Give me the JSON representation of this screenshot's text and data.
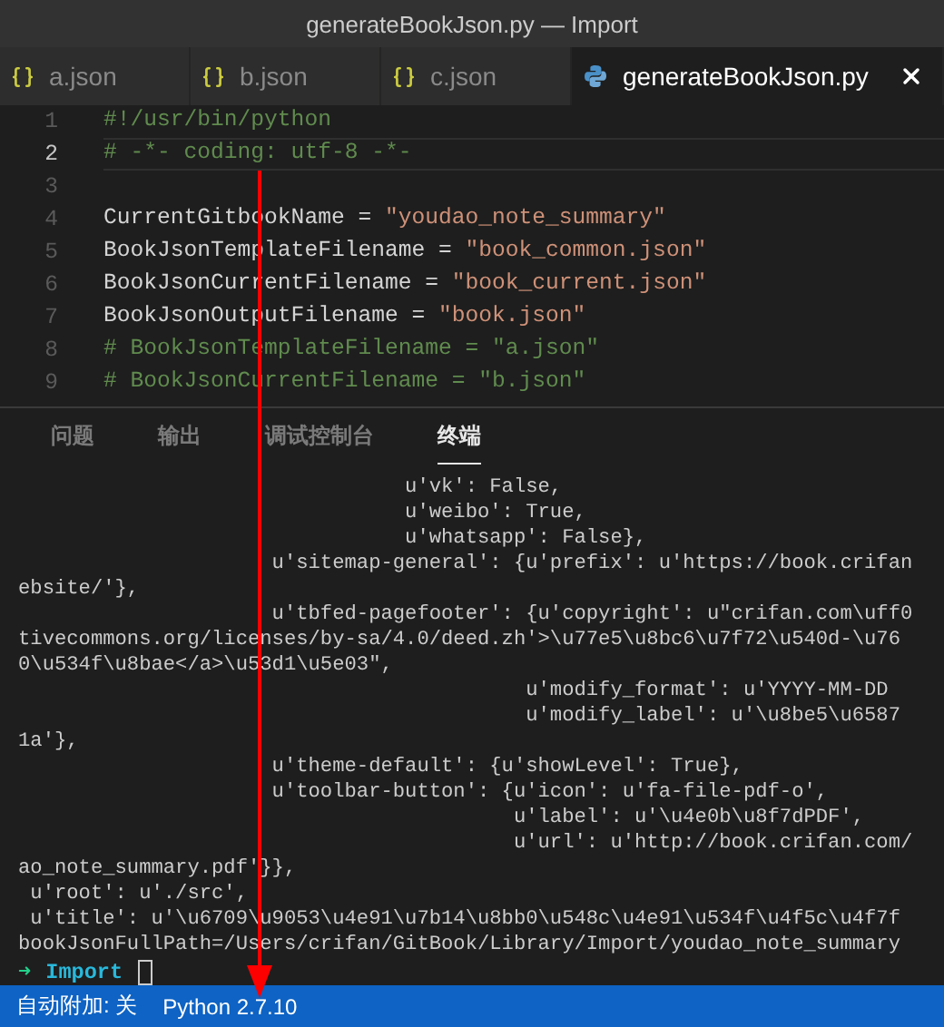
{
  "window": {
    "title": "generateBookJson.py — Import"
  },
  "tabs": [
    {
      "label": "a.json",
      "kind": "json",
      "selected": false
    },
    {
      "label": "b.json",
      "kind": "json",
      "selected": false
    },
    {
      "label": "c.json",
      "kind": "json",
      "selected": false
    },
    {
      "label": "generateBookJson.py",
      "kind": "python",
      "selected": true
    }
  ],
  "editor": {
    "lines": [
      {
        "number": "1",
        "active": false,
        "tokens": [
          {
            "text": "#!/usr/bin/python",
            "kind": "comment"
          }
        ]
      },
      {
        "number": "2",
        "active": true,
        "tokens": [
          {
            "text": "# -*- coding: utf-8 -*-",
            "kind": "comment"
          }
        ]
      },
      {
        "number": "3",
        "active": false
      },
      {
        "number": "4",
        "active": false,
        "tokens": [
          {
            "text": "CurrentGitbookName = ",
            "kind": "plain"
          },
          {
            "text": "\"youdao_note_summary\"",
            "kind": "string"
          }
        ]
      },
      {
        "number": "5",
        "active": false,
        "tokens": [
          {
            "text": "BookJsonTemplateFilename = ",
            "kind": "plain"
          },
          {
            "text": "\"book_common.json\"",
            "kind": "string"
          }
        ]
      },
      {
        "number": "6",
        "active": false,
        "tokens": [
          {
            "text": "BookJsonCurrentFilename = ",
            "kind": "plain"
          },
          {
            "text": "\"book_current.json\"",
            "kind": "string"
          }
        ]
      },
      {
        "number": "7",
        "active": false,
        "tokens": [
          {
            "text": "BookJsonOutputFilename = ",
            "kind": "plain"
          },
          {
            "text": "\"book.json\"",
            "kind": "string"
          }
        ]
      },
      {
        "number": "8",
        "active": false,
        "tokens": [
          {
            "text": "# BookJsonTemplateFilename = \"a.json\"",
            "kind": "comment"
          }
        ]
      },
      {
        "number": "9",
        "active": false,
        "tokens": [
          {
            "text": "# BookJsonCurrentFilename = \"b.json\"",
            "kind": "comment"
          }
        ]
      }
    ]
  },
  "panel": {
    "tabs": [
      {
        "label": "问题",
        "selected": false
      },
      {
        "label": "输出",
        "selected": false
      },
      {
        "label": "调试控制台",
        "selected": false
      },
      {
        "label": "终端",
        "selected": true
      }
    ],
    "terminal": {
      "lines": [
        "                                u'vk': False,",
        "                                u'weibo': True,",
        "                                u'whatsapp': False},",
        "                     u'sitemap-general': {u'prefix': u'https://book.crifan",
        "ebsite/'},",
        "                     u'tbfed-pagefooter': {u'copyright': u\"crifan.com\\uff0",
        "tivecommons.org/licenses/by-sa/4.0/deed.zh'>\\u77e5\\u8bc6\\u7f72\\u540d-\\u76",
        "0\\u534f\\u8bae</a>\\u53d1\\u5e03\",",
        "                                          u'modify_format': u'YYYY-MM-DD",
        "                                          u'modify_label': u'\\u8be5\\u6587",
        "1a'},",
        "                     u'theme-default': {u'showLevel': True},",
        "                     u'toolbar-button': {u'icon': u'fa-file-pdf-o',",
        "                                         u'label': u'\\u4e0b\\u8f7dPDF',",
        "                                         u'url': u'http://book.crifan.com/",
        "ao_note_summary.pdf'}},",
        " u'root': u'./src',",
        " u'title': u'\\u6709\\u9053\\u4e91\\u7b14\\u8bb0\\u548c\\u4e91\\u534f\\u4f5c\\u4f7f",
        "bookJsonFullPath=/Users/crifan/GitBook/Library/Import/youdao_note_summary"
      ],
      "prompt": {
        "arrow": "➜",
        "directory": "Import"
      }
    }
  },
  "status_bar": {
    "items": [
      "自动附加: 关",
      "Python 2.7.10"
    ]
  }
}
